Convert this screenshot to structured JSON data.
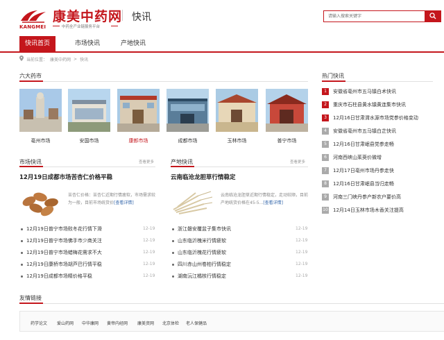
{
  "header": {
    "logo_en": "KANGMEI",
    "logo_cn": "康美中药网",
    "logo_sub": "中药全产业链服务平台",
    "section_name": "快讯",
    "search_placeholder": "请输入搜索关键字"
  },
  "nav": {
    "tabs": [
      {
        "label": "快讯首页",
        "active": true
      },
      {
        "label": "市场快讯",
        "active": false
      },
      {
        "label": "产地快讯",
        "active": false
      }
    ]
  },
  "breadcrumb": {
    "items": [
      "当前位置：",
      "康美中药网",
      "快讯"
    ]
  },
  "markets": {
    "title": "六大药市",
    "items": [
      {
        "label": "亳州市场",
        "highlight": false
      },
      {
        "label": "安国市场",
        "highlight": false
      },
      {
        "label": "康郎市场",
        "highlight": true
      },
      {
        "label": "成都市场",
        "highlight": false
      },
      {
        "label": "玉林市场",
        "highlight": false
      },
      {
        "label": "普宁市场",
        "highlight": false
      }
    ]
  },
  "market_news": {
    "title": "市场快讯",
    "more": "查看更多",
    "headline": "12月19日成都市场苦杏仁价格平稳",
    "desc": "苦杏仁价格：苦杏仁近期行情疲软，市场需求较为一般，目前市场统货价",
    "desc_link": "[查看详情]",
    "list": [
      {
        "text": "12月19日普宁市场败冬花行情下滑",
        "date": "12-19"
      },
      {
        "text": "12月19日普宁市场佛手市少商关注",
        "date": "12-19"
      },
      {
        "text": "12月19日普宁市场蜡梅花需求不大",
        "date": "12-19"
      },
      {
        "text": "12月19日康桥市场胡芦巴行情平稳",
        "date": "12-19"
      },
      {
        "text": "12月19日成都市场精价格平稳",
        "date": "12-19"
      }
    ]
  },
  "origin_news": {
    "title": "产地快讯",
    "more": "查看更多",
    "headline": "云南临沧龙胆草行情稳定",
    "desc": "云南临沧龙胆草近期行情稳定，走动较顺，目前产地统货价格在45-5...",
    "desc_link": "[查看详情]",
    "list": [
      {
        "text": "浙江磐安覆盆子集市快讯",
        "date": "12-19"
      },
      {
        "text": "山东临沂槐米行情疲软",
        "date": "12-19"
      },
      {
        "text": "山东临沂槐花行情疲软",
        "date": "12-19"
      },
      {
        "text": "四川赤山州卷柏行情稳定",
        "date": "12-19"
      },
      {
        "text": "湖南沅江橘核行情稳定",
        "date": "12-19"
      }
    ]
  },
  "hot_news": {
    "title": "热门快讯",
    "items": [
      {
        "num": "1",
        "text": "安徽省亳州市五马镇白术快讯"
      },
      {
        "num": "2",
        "text": "重庆市石柱县黄水镇黄连集市快讯"
      },
      {
        "num": "3",
        "text": "12月16日甘肃渭水源市场党参价格变动"
      },
      {
        "num": "4",
        "text": "安徽省亳州市五马镇白芷快讯"
      },
      {
        "num": "5",
        "text": "12月16日甘肃岷县党参走畅"
      },
      {
        "num": "6",
        "text": "河南西峡山茱萸价微增"
      },
      {
        "num": "7",
        "text": "12月17日亳州市场丹参走快"
      },
      {
        "num": "8",
        "text": "12月16日甘肃岷县当归走畅"
      },
      {
        "num": "9",
        "text": "河南三门峡丹参产新农户要价高"
      },
      {
        "num": "10",
        "text": "12月14日玉林市场木香关注提高"
      }
    ]
  },
  "friend_links": {
    "title": "友情链接",
    "items": [
      "药学论文",
      "爱山药网",
      "中华康网",
      "黄帝内经网",
      "康美资网",
      "北京体检",
      "老人保健品"
    ]
  },
  "colors": {
    "brand_red": "#c4161c",
    "link_blue": "#3366aa"
  }
}
